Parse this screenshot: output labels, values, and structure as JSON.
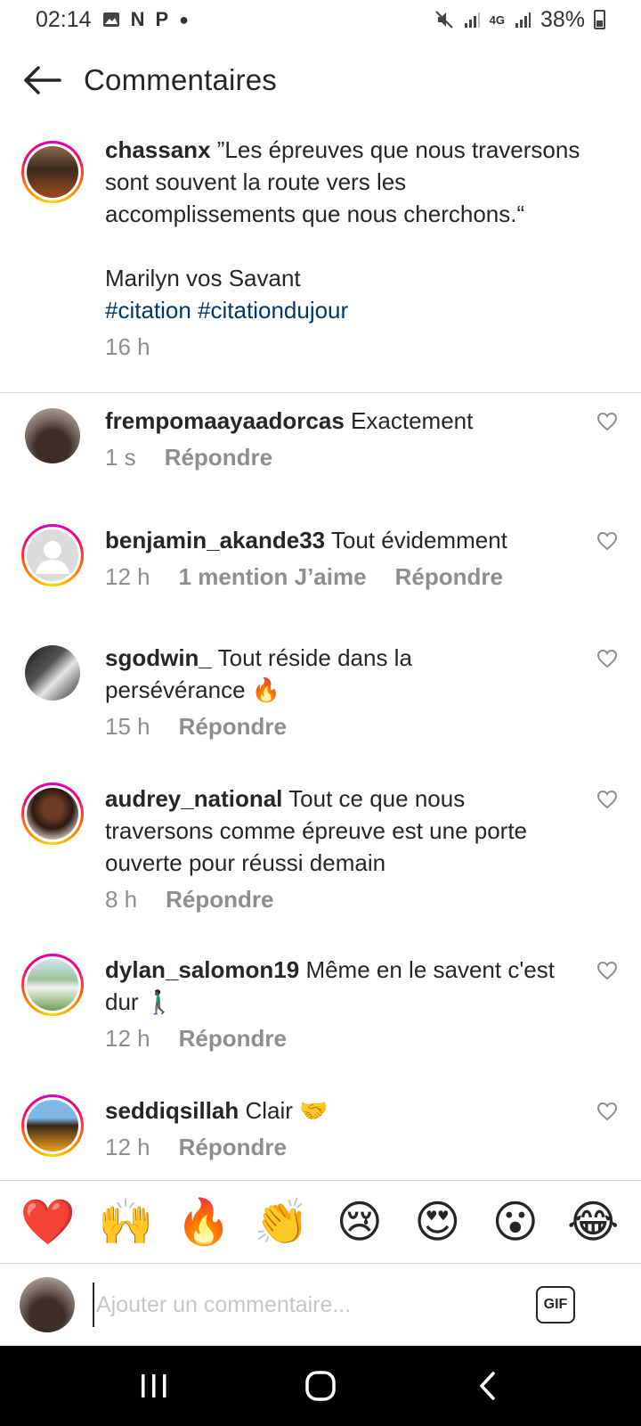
{
  "status_bar": {
    "time": "02:14",
    "left_icons": [
      "image-icon",
      "n-icon",
      "p-icon",
      "dot-icon"
    ],
    "network": "4G",
    "battery": "38%"
  },
  "header": {
    "title": "Commentaires",
    "back_icon": "arrow-left-icon"
  },
  "post": {
    "username": "chassanx",
    "quote": "”Les épreuves que nous traversons sont souvent la route vers les accomplissements que nous cherchons.“",
    "author": "Marilyn vos Savant",
    "hashtags": "#citation #citationdujour",
    "time": "16 h"
  },
  "comments": [
    {
      "username": "frempomaayaadorcas",
      "text": "Exactement",
      "time": "1 s",
      "likes": "",
      "reply": "Répondre"
    },
    {
      "username": "benjamin_akande33",
      "text": "Tout évidemment",
      "time": "12 h",
      "likes": "1 mention J’aime",
      "reply": "Répondre"
    },
    {
      "username": "sgodwin_",
      "text": "Tout réside dans la persévérance 🔥",
      "time": "15 h",
      "likes": "",
      "reply": "Répondre"
    },
    {
      "username": "audrey_national",
      "text": "Tout ce que nous traversons comme épreuve est une porte ouverte pour réussi demain",
      "time": "8 h",
      "likes": "",
      "reply": "Répondre"
    },
    {
      "username": "dylan_salomon19",
      "text": "Même en le savent c'est dur 🚶🏿‍♂️",
      "time": "12 h",
      "likes": "",
      "reply": "Répondre"
    },
    {
      "username": "seddiqsillah",
      "text": "Clair 🤝",
      "time": "12 h",
      "likes": "",
      "reply": "Répondre"
    }
  ],
  "emoji_bar": [
    "❤️",
    "🙌",
    "🔥",
    "👏",
    "😢",
    "😍",
    "😮",
    "😂"
  ],
  "compose": {
    "placeholder": "Ajouter un commentaire...",
    "gif_label": "GIF"
  },
  "nav": {
    "recents_icon": "recents-icon",
    "home_icon": "home-icon",
    "back_icon": "back-chevron-icon"
  },
  "colors": {
    "hashtag": "#00376b",
    "secondary_text": "#8e8e8e",
    "divider": "#dbdbdb",
    "story_ring": "#ff0069"
  }
}
